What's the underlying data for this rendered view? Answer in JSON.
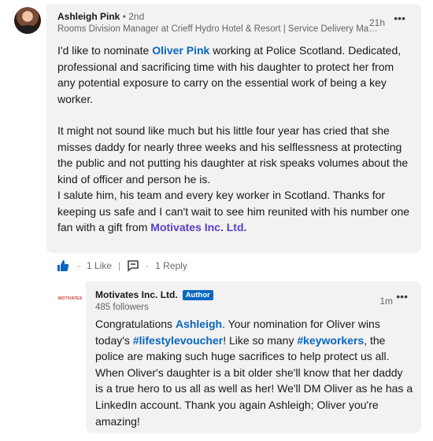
{
  "comment": {
    "author_name": "Ashleigh Pink",
    "degree": "• 2nd",
    "headline": "Rooms Division Manager at Crieff Hydro Hotel & Resort | Service Delivery Manager",
    "time": "21h",
    "more": "•••",
    "p1_a": "I'd like to nominate ",
    "p1_mention": "Oliver Pink",
    "p1_b": " working at Police Scotland. Dedicated, professional and sacrificing time with his daughter to protect her from any potential exposure to carry on the essential work of being a key worker.",
    "p2": "It might not sound like much but his little four year has cried that she misses daddy for nearly three weeks and his selflessness at protecting the public and not putting his daughter at risk speaks volumes about the kind of officer and person he is.",
    "p3_a": "I salute him, his team and every key worker in Scotland. Thanks for keeping us safe and I can't wait to see him reunited with his number one fan with a gift from ",
    "p3_company": "Motivates Inc. Ltd.",
    "p3_b": "",
    "likes": "1 Like",
    "replies": "1 Reply",
    "dot": "·"
  },
  "reply": {
    "logo_text": "MOTIVATES",
    "author_name": "Motivates Inc. Ltd.",
    "badge": "Author",
    "followers": "485 followers",
    "time": "1m",
    "more": "•••",
    "t1": "Congratulations ",
    "mention": "Ashleigh",
    "t2": ". Your nomination for Oliver wins today's ",
    "hashtag1": "#lifestylevoucher",
    "t3": "! Like so many ",
    "hashtag2": "#keyworkers",
    "t4": ", the police are making such huge sacrifices to help protect us all. When Oliver's daughter is a bit older she'll know that her daddy is a true hero to us all as well as her! We'll DM Oliver as he has a LinkedIn account. Thank you again Ashleigh; Oliver you're amazing!"
  },
  "colors": {
    "link": "#0a66c2",
    "company": "#5a40c4",
    "bubble": "#f2f2f2"
  }
}
